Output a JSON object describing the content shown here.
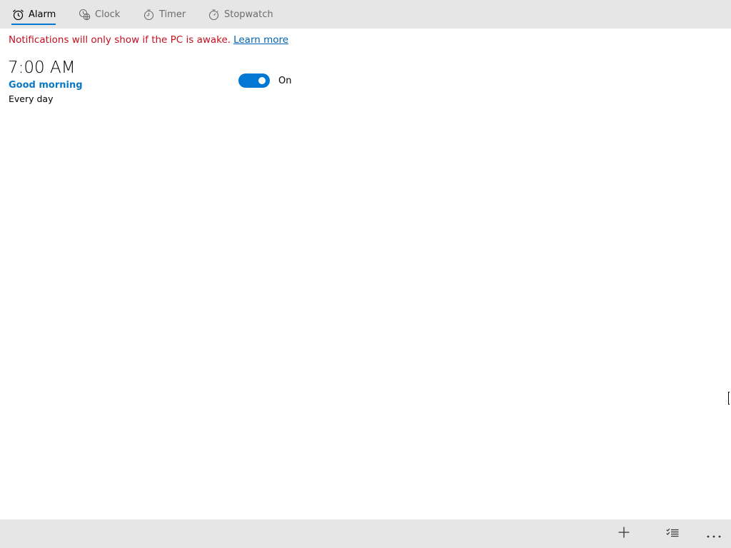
{
  "tabs": [
    {
      "label": "Alarm",
      "icon": "alarm-clock-icon",
      "active": true
    },
    {
      "label": "Clock",
      "icon": "world-clock-icon",
      "active": false
    },
    {
      "label": "Timer",
      "icon": "timer-icon",
      "active": false
    },
    {
      "label": "Stopwatch",
      "icon": "stopwatch-icon",
      "active": false
    }
  ],
  "notice": {
    "text": "Notifications will only show if the PC is awake.",
    "link": "Learn more"
  },
  "alarms": [
    {
      "time": "7:00 AM",
      "name": "Good morning",
      "repeat": "Every day",
      "toggle_label": "On",
      "enabled": true
    }
  ],
  "commands": [
    {
      "icon": "add-icon"
    },
    {
      "icon": "select-alarms-icon"
    },
    {
      "icon": "more-icon"
    }
  ],
  "colors": {
    "accent": "#0078d4",
    "warning_text": "#c50f1f",
    "link": "#0063b1",
    "alarm_name": "#0b78c4",
    "bar_background": "#e6e6e6"
  }
}
